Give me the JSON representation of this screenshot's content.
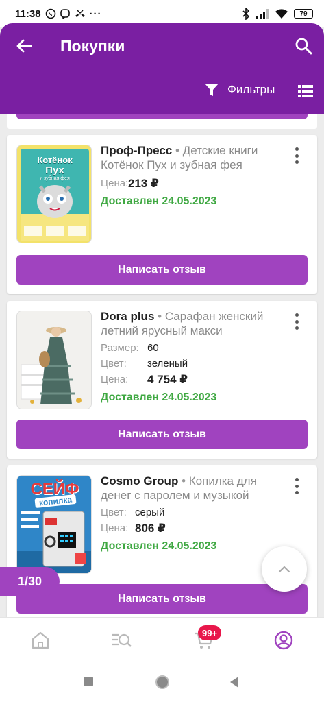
{
  "status_bar": {
    "time": "11:38",
    "battery": "79"
  },
  "header": {
    "title": "Покупки",
    "filters_label": "Фильтры"
  },
  "orders": [
    {
      "brand": "Проф-Пресс",
      "product": "Детские книги Котёнок Пух и зубная фея",
      "price_label": "Цена:",
      "price": "213 ₽",
      "status": "Доставлен 24.05.2023",
      "review_label": "Написать отзыв"
    },
    {
      "brand": "Dora plus",
      "product": "Сарафан женский летний ярусный макси",
      "size_label": "Размер:",
      "size": "60",
      "color_label": "Цвет:",
      "color": "зеленый",
      "price_label": "Цена:",
      "price": "4 754 ₽",
      "status": "Доставлен 24.05.2023",
      "review_label": "Написать отзыв"
    },
    {
      "brand": "Cosmo Group",
      "product": "Копилка для денег с паролем и музыкой",
      "color_label": "Цвет:",
      "color": "серый",
      "price_label": "Цена:",
      "price": "806 ₽",
      "status": "Доставлен 24.05.2023",
      "review_label": "Написать отзыв"
    }
  ],
  "book_cover": {
    "title_line1": "Котёнок",
    "title_line2": "Пух",
    "subtitle": "и зубная фея"
  },
  "safe_cover": {
    "title": "СЕЙФ",
    "subtitle": "копилка"
  },
  "pager": "1/30",
  "cart_badge": "99+",
  "colors": {
    "header": "#7a1fa2",
    "button": "#a043bf",
    "delivered": "#3fa842",
    "badge": "#e8174b"
  },
  "icons": [
    "back-arrow-icon",
    "search-icon",
    "filter-icon",
    "list-view-icon",
    "home-icon",
    "catalog-search-icon",
    "cart-icon",
    "profile-icon",
    "chevron-up-icon"
  ]
}
